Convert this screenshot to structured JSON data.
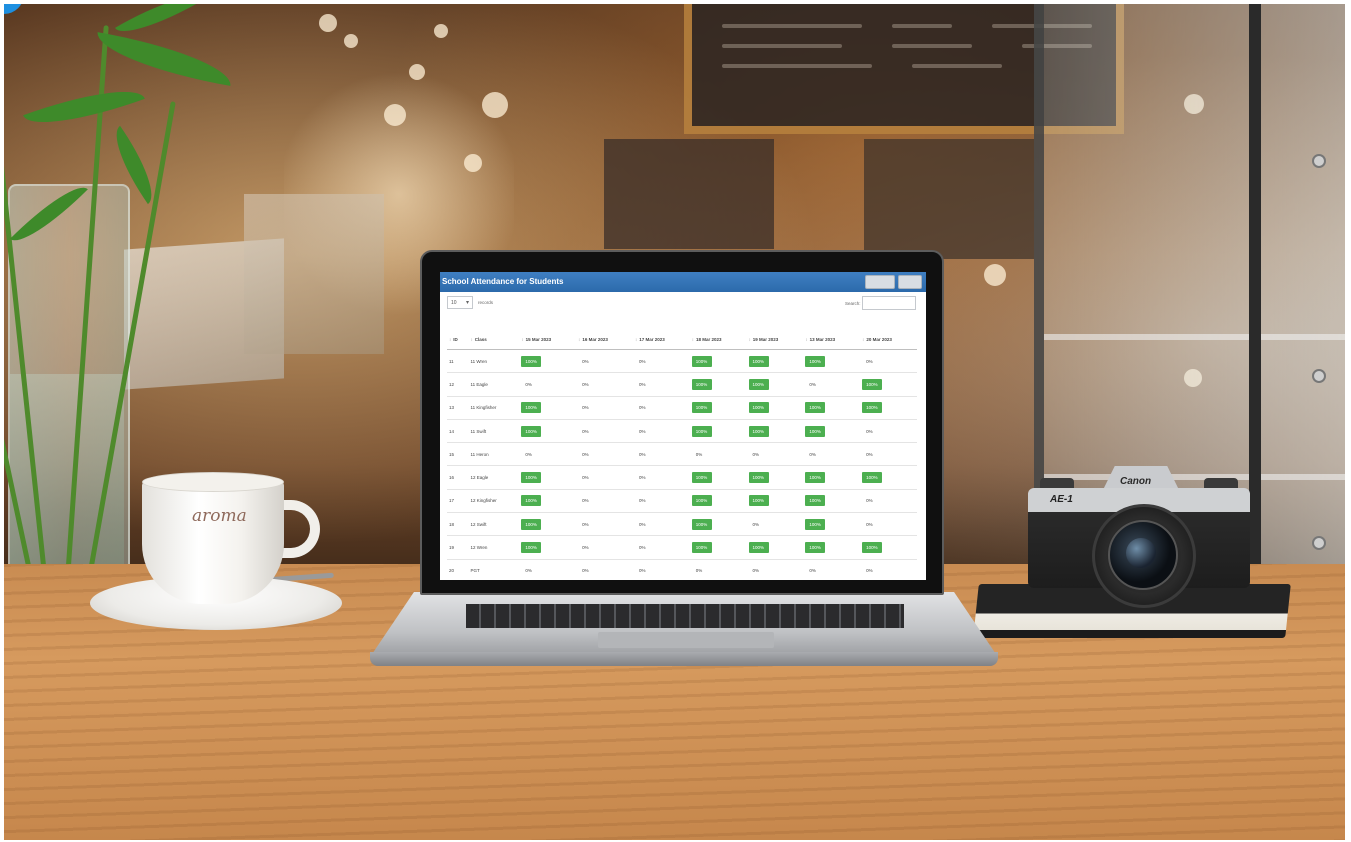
{
  "scene": {
    "cup_logo": "aroma",
    "camera_brand": "Canon",
    "camera_model": "AE-1"
  },
  "app": {
    "title": "School Attendance for Students",
    "length_value": "10",
    "length_label": "records",
    "search_label": "Search:",
    "search_value": "",
    "columns": [
      "ID",
      "Class",
      "15 Mar 2023",
      "16 Mar 2023",
      "17 Mar 2023",
      "18 Mar 2023",
      "19 Mar 2023",
      "13 Mar 2023",
      "20 Mar 2023"
    ],
    "rows": [
      {
        "id": "11",
        "class": "11 Wren",
        "cells": [
          "100%",
          "0%",
          "0%",
          "100%",
          "100%",
          "100%",
          "0%"
        ]
      },
      {
        "id": "12",
        "class": "11 Eagle",
        "cells": [
          "0%",
          "0%",
          "0%",
          "100%",
          "100%",
          "0%",
          "100%"
        ]
      },
      {
        "id": "13",
        "class": "11 Kingfisher",
        "cells": [
          "100%",
          "0%",
          "0%",
          "100%",
          "100%",
          "100%",
          "100%"
        ]
      },
      {
        "id": "14",
        "class": "11 Swift",
        "cells": [
          "100%",
          "0%",
          "0%",
          "100%",
          "100%",
          "100%",
          "0%"
        ]
      },
      {
        "id": "15",
        "class": "11 Heron",
        "cells": [
          "0%",
          "0%",
          "0%",
          "0%",
          "0%",
          "0%",
          "0%"
        ]
      },
      {
        "id": "16",
        "class": "12 Eagle",
        "cells": [
          "100%",
          "0%",
          "0%",
          "100%",
          "100%",
          "100%",
          "100%"
        ]
      },
      {
        "id": "17",
        "class": "12 Kingfisher",
        "cells": [
          "100%",
          "0%",
          "0%",
          "100%",
          "100%",
          "100%",
          "0%"
        ]
      },
      {
        "id": "18",
        "class": "12 Swift",
        "cells": [
          "100%",
          "0%",
          "0%",
          "100%",
          "0%",
          "100%",
          "0%"
        ]
      },
      {
        "id": "19",
        "class": "12 Wren",
        "cells": [
          "100%",
          "0%",
          "0%",
          "100%",
          "100%",
          "100%",
          "100%"
        ]
      },
      {
        "id": "20",
        "class": "PGT",
        "cells": [
          "0%",
          "0%",
          "0%",
          "0%",
          "0%",
          "0%",
          "0%"
        ]
      }
    ]
  },
  "colors": {
    "header_blue": "#2c6aab",
    "present_green": "#4caf50"
  }
}
